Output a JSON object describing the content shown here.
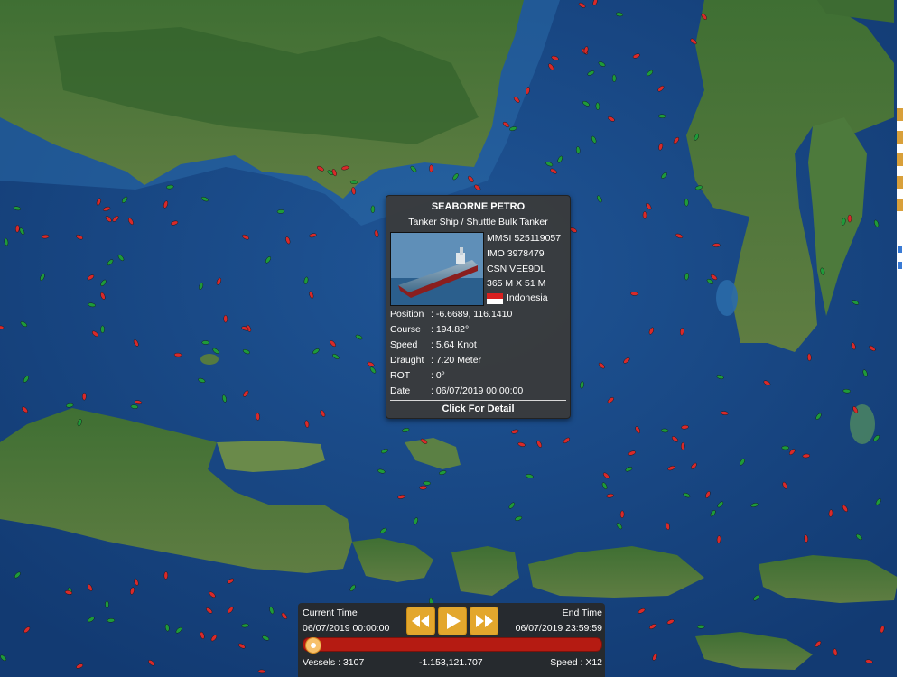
{
  "vessel": {
    "name": "SEABORNE PETRO",
    "type": "Tanker Ship / Shuttle Bulk Tanker",
    "mmsi": "MMSI 525119057",
    "imo": "IMO 3978479",
    "csn": "CSN VEE9DL",
    "dimensions": "365 M X 51 M",
    "country": "Indonesia",
    "details": [
      {
        "label": "Position",
        "value": ": -6.6689, 116.1410"
      },
      {
        "label": "Course",
        "value": ": 194.82°"
      },
      {
        "label": "Speed",
        "value": ": 5.64 Knot"
      },
      {
        "label": "Draught",
        "value": ": 7.20 Meter"
      },
      {
        "label": "ROT",
        "value": ": 0°"
      },
      {
        "label": "Date",
        "value": ": 06/07/2019 00:00:00"
      }
    ],
    "detail_link": "Click For Detail"
  },
  "player": {
    "current_label": "Current Time",
    "current_value": "06/07/2019 00:00:00",
    "end_label": "End Time",
    "end_value": "06/07/2019 23:59:59",
    "vessels": "Vessels : 3107",
    "coords": "-1.153,121.707",
    "speed": "Speed : X12",
    "progress": 0.01
  },
  "colors": {
    "sea": "#1b4a86",
    "land": "#4a7a3a",
    "vessel_moving": "#d82a2a",
    "vessel_stopped": "#1f9a3a",
    "accent": "#e3a72d"
  },
  "icons": {
    "rewind": "rewind-icon",
    "play": "play-icon",
    "forward": "fast-forward-icon"
  }
}
